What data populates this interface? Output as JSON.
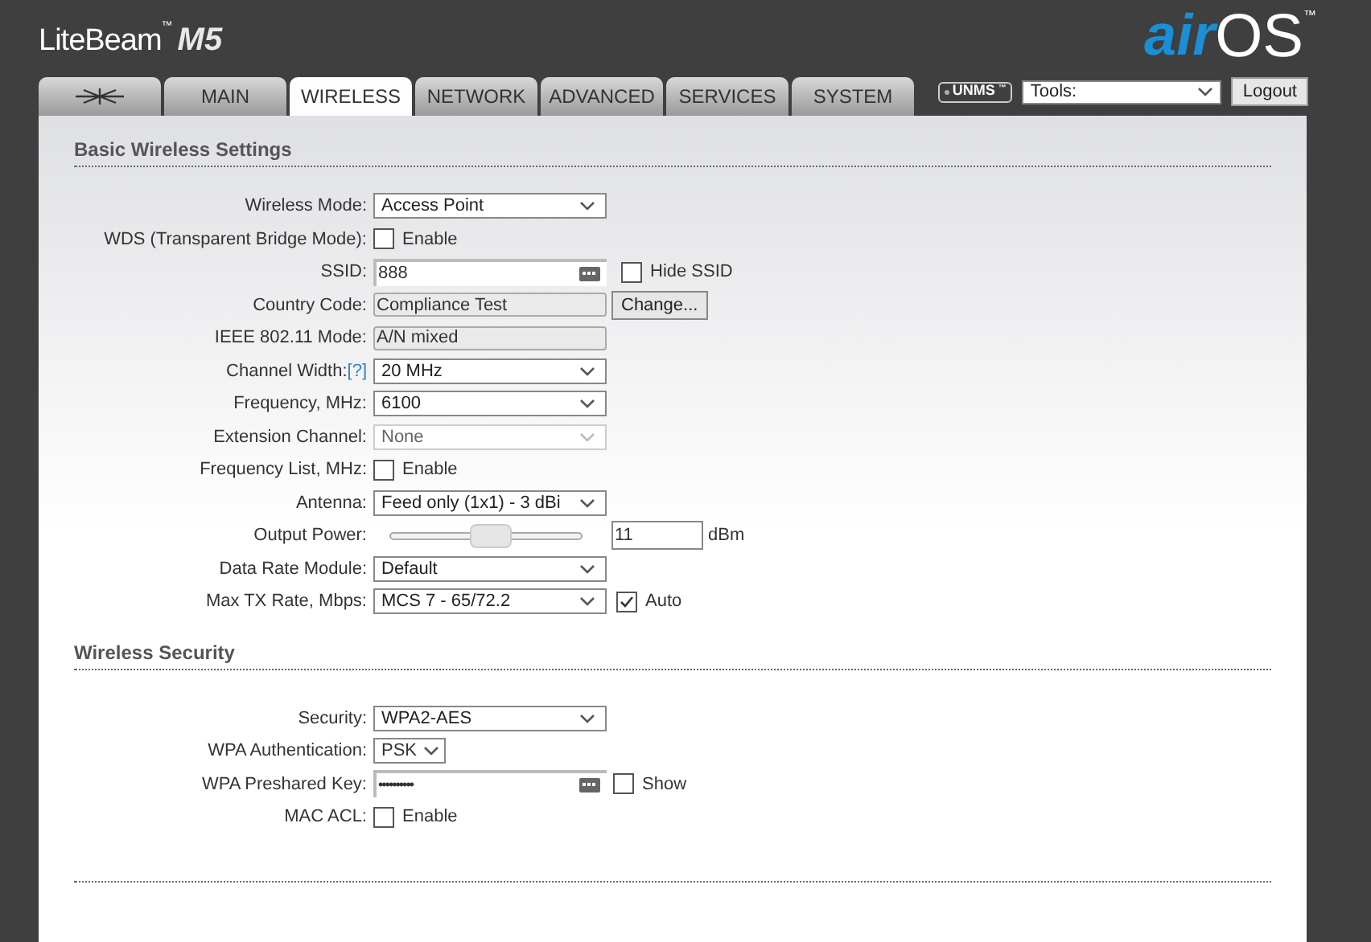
{
  "brand": {
    "product": "LiteBeam",
    "product_tm": "™",
    "model": "M5",
    "logo_air": "air",
    "logo_os": "OS",
    "logo_tm": "™"
  },
  "tabs": [
    {
      "kind": "icon",
      "selected": false
    },
    {
      "kind": "text",
      "label": "MAIN",
      "selected": false
    },
    {
      "kind": "text",
      "label": "WIRELESS",
      "selected": true
    },
    {
      "kind": "text",
      "label": "NETWORK",
      "selected": false
    },
    {
      "kind": "text",
      "label": "ADVANCED",
      "selected": false
    },
    {
      "kind": "text",
      "label": "SERVICES",
      "selected": false
    },
    {
      "kind": "text",
      "label": "SYSTEM",
      "selected": false
    }
  ],
  "toolbar": {
    "unms": "UNMS",
    "unms_tm": "™",
    "tools": "Tools:",
    "logout": "Logout"
  },
  "sections": [
    {
      "title": "Basic Wireless Settings",
      "rows": [
        {
          "kind": "select",
          "label": "Wireless Mode:",
          "value": "Access Point",
          "disabled": false
        },
        {
          "kind": "checkbox",
          "label": "WDS (Transparent Bridge Mode):",
          "checked": false,
          "text": "Enable"
        },
        {
          "kind": "text",
          "label": "SSID:",
          "value": "888",
          "extra": {
            "checked": false,
            "text": "Hide SSID"
          }
        },
        {
          "kind": "readonly",
          "label": "Country Code:",
          "value": "Compliance Test",
          "button": "Change..."
        },
        {
          "kind": "readonly",
          "label": "IEEE 802.11 Mode:",
          "value": "A/N mixed"
        },
        {
          "kind": "select",
          "label": "Channel Width:",
          "help": "[?]",
          "value": "20 MHz",
          "disabled": false
        },
        {
          "kind": "select",
          "label": "Frequency, MHz:",
          "value": "6100",
          "disabled": false
        },
        {
          "kind": "select",
          "label": "Extension Channel:",
          "value": "None",
          "disabled": true
        },
        {
          "kind": "checkbox",
          "label": "Frequency List, MHz:",
          "checked": false,
          "text": "Enable"
        },
        {
          "kind": "select",
          "label": "Antenna:",
          "value": "Feed only (1x1) - 3 dBi",
          "disabled": false
        },
        {
          "kind": "slider",
          "label": "Output Power:",
          "level": 0.53,
          "value": "11",
          "unit": "dBm"
        },
        {
          "kind": "select",
          "label": "Data Rate Module:",
          "value": "Default",
          "disabled": false
        },
        {
          "kind": "select",
          "label": "Max TX Rate, Mbps:",
          "value": "MCS 7 - 65/72.2",
          "disabled": false,
          "extra": {
            "checked": true,
            "text": "Auto"
          }
        }
      ]
    },
    {
      "title": "Wireless Security",
      "rows": [
        {
          "kind": "select",
          "label": "Security:",
          "value": "WPA2-AES",
          "disabled": false
        },
        {
          "kind": "small_select",
          "label": "WPA Authentication:",
          "value": "PSK"
        },
        {
          "kind": "password",
          "label": "WPA Preshared Key:",
          "value": "••••••••••",
          "extra": {
            "checked": false,
            "text": "Show"
          }
        },
        {
          "kind": "checkbox",
          "label": "MAC ACL:",
          "checked": false,
          "text": "Enable"
        }
      ]
    }
  ]
}
